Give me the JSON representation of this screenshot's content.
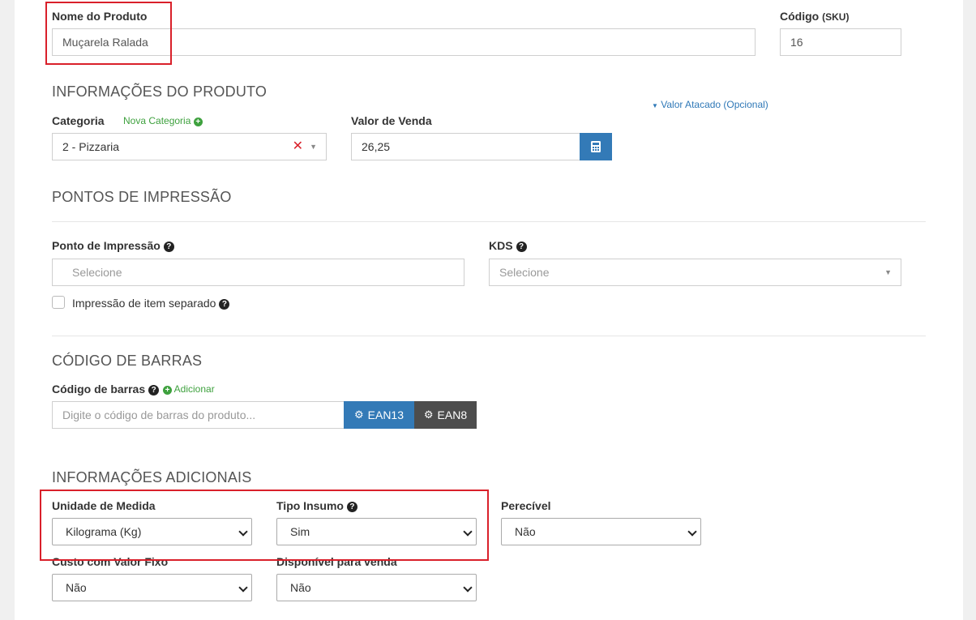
{
  "product": {
    "name_label": "Nome do Produto",
    "name_value": "Muçarela Ralada",
    "code_label": "Código",
    "code_suffix": "(SKU)",
    "code_value": "16"
  },
  "info": {
    "title": "INFORMAÇÕES DO PRODUTO",
    "wholesale_link": "Valor Atacado (Opcional)",
    "category_label": "Categoria",
    "new_category_link": "Nova Categoria",
    "category_value": "2 - Pizzaria",
    "price_label": "Valor de Venda",
    "price_value": "26,25"
  },
  "print": {
    "title": "PONTOS DE IMPRESSÃO",
    "point_label": "Ponto de Impressão",
    "point_placeholder": "Selecione",
    "kds_label": "KDS",
    "kds_placeholder": "Selecione",
    "separate_label": "Impressão de item separado",
    "separate_checked": false
  },
  "barcode": {
    "title": "CÓDIGO DE BARRAS",
    "label": "Código de barras",
    "add_link": "Adicionar",
    "placeholder": "Digite o código de barras do produto...",
    "ean13_label": "EAN13",
    "ean8_label": "EAN8"
  },
  "additional": {
    "title": "INFORMAÇÕES ADICIONAIS",
    "unit_label": "Unidade de Medida",
    "unit_value": "Kilograma (Kg)",
    "input_type_label": "Tipo Insumo",
    "input_type_value": "Sim",
    "perishable_label": "Perecível",
    "perishable_value": "Não",
    "fixed_cost_label": "Custo com Valor Fixo",
    "fixed_cost_value": "Não",
    "available_label": "Disponível para venda",
    "available_value": "Não"
  },
  "colors": {
    "primary": "#337ab7",
    "dark": "#4d4d4d",
    "success": "#3ea13e",
    "danger": "#d9202a",
    "highlight": "#d9202a"
  },
  "icons": {
    "calculator": "calculator-icon",
    "question": "question-circle-icon",
    "plus": "plus-circle-icon",
    "gear": "gear-icon",
    "clear": "clear-x-icon"
  }
}
